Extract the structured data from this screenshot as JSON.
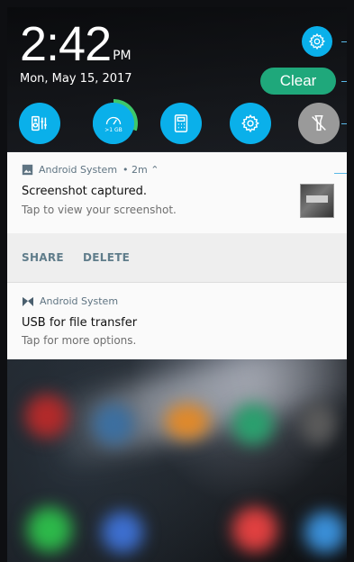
{
  "status": {
    "time": "2:42",
    "ampm": "PM",
    "date": "Mon, May 15, 2017"
  },
  "header": {
    "clear_label": "Clear"
  },
  "quick_settings": [
    {
      "name": "audio-wizard-icon",
      "state": "on"
    },
    {
      "name": "boost-icon",
      "caption": ">1 GB",
      "state": "on",
      "boost_progress": 0.3
    },
    {
      "name": "calculator-icon",
      "state": "on"
    },
    {
      "name": "settings-icon",
      "state": "on"
    },
    {
      "name": "flashlight-icon",
      "state": "off"
    }
  ],
  "notifications": [
    {
      "app": "Android System",
      "meta": "• 2m ⌃",
      "title": "Screenshot captured.",
      "body": "Tap to view your screenshot.",
      "actions": [
        "SHARE",
        "DELETE"
      ]
    },
    {
      "app": "Android System",
      "title": "USB for file transfer",
      "body": "Tap for more options."
    }
  ],
  "colors": {
    "accent": "#0ab0ea",
    "clear": "#1fa87b",
    "action_text": "#607d8b"
  }
}
